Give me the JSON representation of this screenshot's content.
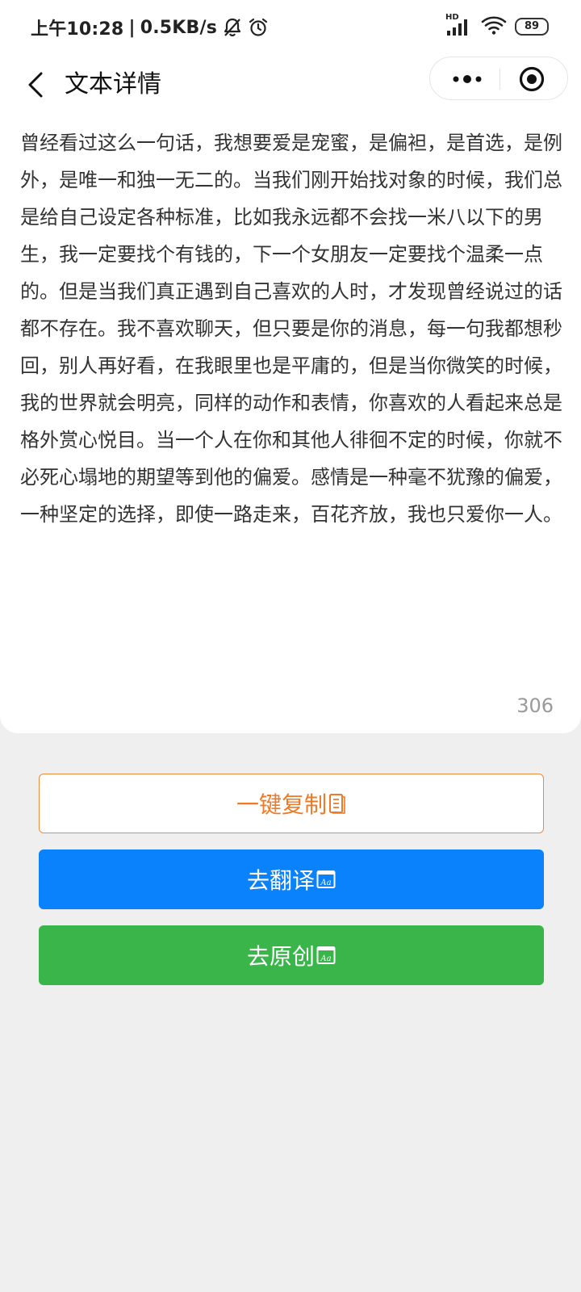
{
  "status_bar": {
    "time": "上午10:28",
    "separator": "|",
    "network_speed": "0.5KB/s",
    "signal_label": "HD",
    "battery_level": "89",
    "icons": [
      "bell-muted-icon",
      "alarm-icon",
      "signal-icon",
      "wifi-icon",
      "battery-icon"
    ]
  },
  "nav": {
    "title": "文本详情",
    "icons": [
      "back-chevron-icon",
      "more-dots-icon",
      "target-icon"
    ]
  },
  "content": {
    "text": "曾经看过这么一句话，我想要爱是宠蜜，是偏袒，是首选，是例外，是唯一和独一无二的。当我们刚开始找对象的时候，我们总是给自己设定各种标准，比如我永远都不会找一米八以下的男生，我一定要找个有钱的，下一个女朋友一定要找个温柔一点的。但是当我们真正遇到自己喜欢的人时，才发现曾经说过的话都不存在。我不喜欢聊天，但只要是你的消息，每一句我都想秒回，别人再好看，在我眼里也是平庸的，但是当你微笑的时候，我的世界就会明亮，同样的动作和表情，你喜欢的人看起来总是格外赏心悦目。当一个人在你和其他人徘徊不定的时候，你就不必死心塌地的期望等到他的偏爱。感情是一种毫不犹豫的偏爱，一种坚定的选择，即使一路走来，百花齐放，我也只爱你一人。",
    "char_count": "306"
  },
  "actions": {
    "copy_label": "一键复制",
    "translate_label": "去翻译",
    "original_label": "去原创",
    "copy_color": "#ee7a26",
    "translate_color": "#0a82fc",
    "original_color": "#39b54a"
  }
}
